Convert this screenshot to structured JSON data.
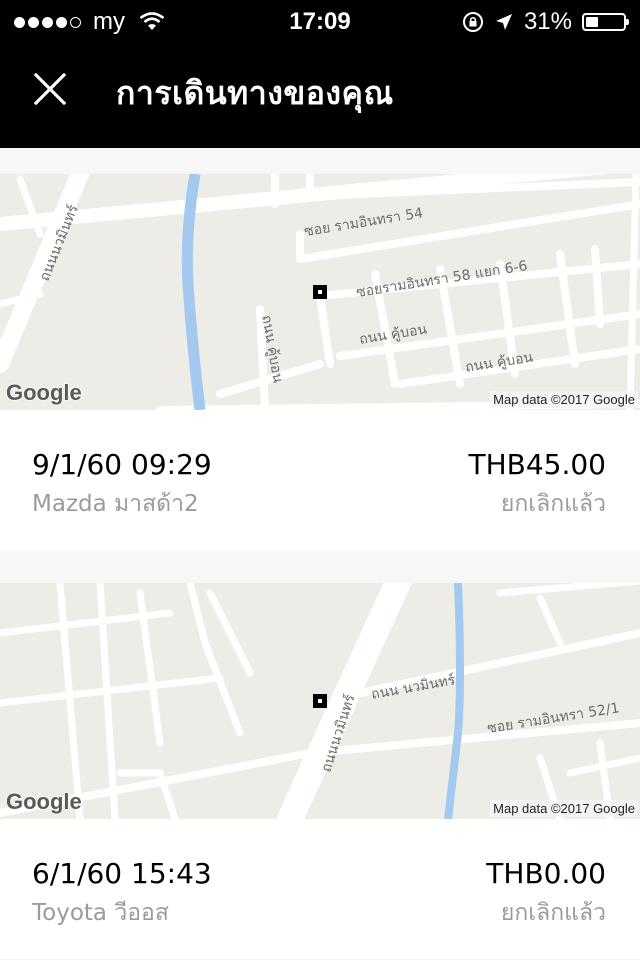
{
  "status_bar": {
    "carrier": "my",
    "time": "17:09",
    "battery": "31%",
    "signal_bars": 4,
    "battery_level": 0.31
  },
  "header": {
    "close_icon": "close-icon",
    "title": "การเดินทางของคุณ"
  },
  "trips": [
    {
      "date": "9/1/60 09:29",
      "car": "Mazda มาสด้า2",
      "price": "THB45.00",
      "status": "ยกเลิกแล้ว",
      "map": {
        "google_logo": "Google",
        "credit": "Map data ©2017 Google",
        "labels": [
          "ซอย รามอินทรา 54",
          "ซอยรามอินทรา 58 แยก 6-6",
          "ถนน คู้บอน",
          "ถนน คู้บอน",
          "ถนน คู้บอน",
          "ถนนนวมินทร์"
        ]
      }
    },
    {
      "date": "6/1/60 15:43",
      "car": "Toyota วีออส",
      "price": "THB0.00",
      "status": "ยกเลิกแล้ว",
      "map": {
        "google_logo": "Google",
        "credit": "Map data ©2017 Google",
        "labels": [
          "ถนน นวมินทร์",
          "ซอย รามอินทรา 52/1",
          "ถนนนวมินทร์"
        ]
      }
    }
  ]
}
